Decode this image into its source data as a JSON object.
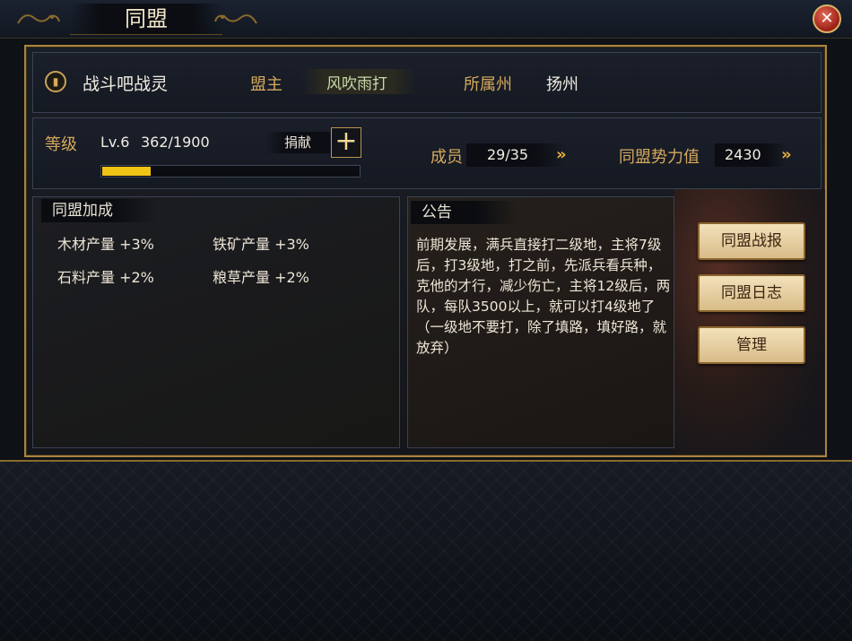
{
  "window": {
    "title": "同盟",
    "close_icon": "close-icon"
  },
  "alliance": {
    "icon": "banner-icon",
    "name": "战斗吧战灵",
    "leader_label": "盟主",
    "leader_name": "风吹雨打",
    "state_label": "所属州",
    "state_name": "扬州"
  },
  "level": {
    "label": "等级",
    "value": "Lv.6",
    "exp": "362/1900",
    "progress_fraction": 0.19,
    "donate_label": "捐献",
    "plus_icon": "plus-icon"
  },
  "members": {
    "label": "成员",
    "value": "29/35",
    "chevron_icon": "double-chevron-right-icon"
  },
  "power": {
    "label": "同盟势力值",
    "value": "2430",
    "chevron_icon": "double-chevron-right-icon"
  },
  "bonus": {
    "title": "同盟加成",
    "items": [
      "木材产量 +3%",
      "铁矿产量 +3%",
      "石料产量 +2%",
      "粮草产量 +2%"
    ]
  },
  "notice": {
    "title": "公告",
    "text": "前期发展，满兵直接打二级地，主将7级后，打3级地，打之前，先派兵看兵种，克他的才行，减少伤亡，主将12级后，两队，每队3500以上，就可以打4级地了（一级地不要打，除了填路，填好路，就放弃）"
  },
  "actions": {
    "report": "同盟战报",
    "log": "同盟日志",
    "manage": "管理"
  },
  "colors": {
    "accent_gold": "#d6a95c",
    "progress": "#f0c415",
    "button_bg": "#e8d3a6",
    "close_red": "#b02a1c"
  }
}
